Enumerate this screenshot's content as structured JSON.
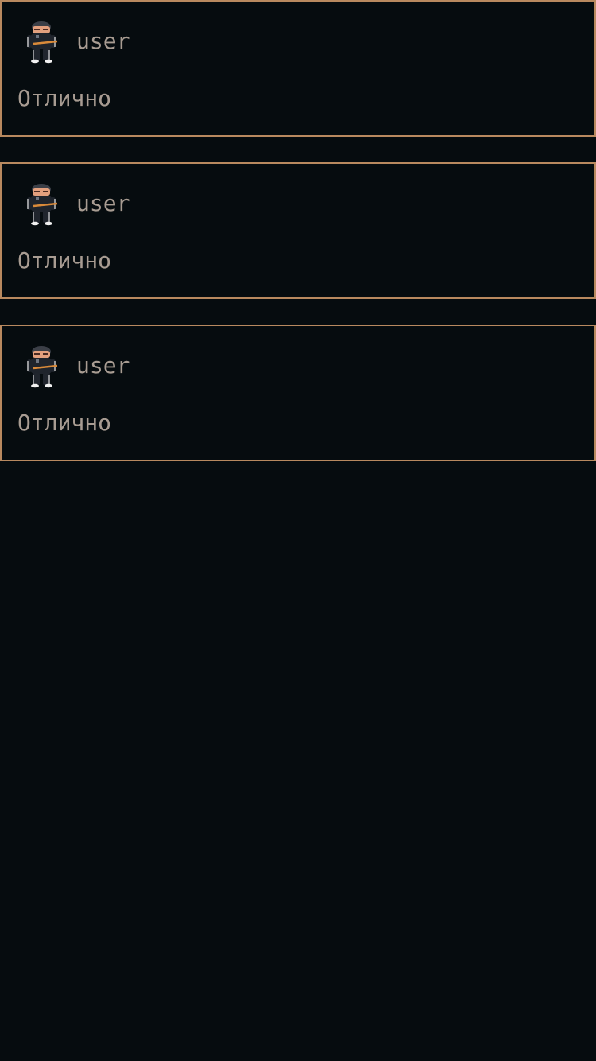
{
  "posts": [
    {
      "author": "user",
      "avatar_icon": "avatar-character-icon",
      "text": "Отлично"
    },
    {
      "author": "user",
      "avatar_icon": "avatar-character-icon",
      "text": "Отлично"
    },
    {
      "author": "user",
      "avatar_icon": "avatar-character-icon",
      "text": "Отлично"
    }
  ],
  "colors": {
    "background": "#060c0f",
    "card_border": "#b8895f",
    "text": "#a89c92"
  }
}
